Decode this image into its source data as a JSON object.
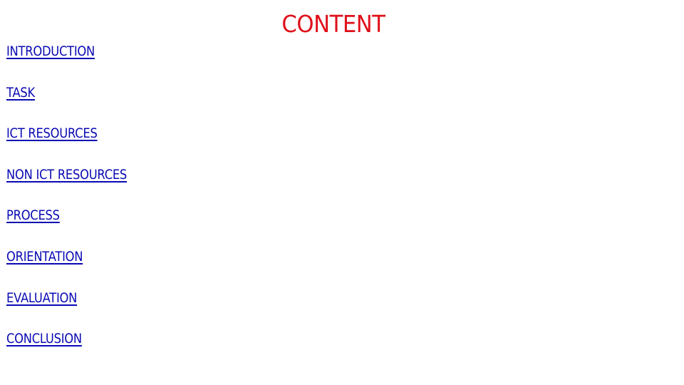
{
  "slide": {
    "title": "CONTENT",
    "title_color": "#e0101a",
    "link_color": "#0a0ab4",
    "items": [
      {
        "label": "INTRODUCTION"
      },
      {
        "label": "TASK"
      },
      {
        "label": "ICT RESOURCES"
      },
      {
        "label": "NON ICT RESOURCES"
      },
      {
        "label": "PROCESS"
      },
      {
        "label": "ORIENTATION"
      },
      {
        "label": "EVALUATION"
      },
      {
        "label": "CONCLUSION"
      }
    ]
  }
}
